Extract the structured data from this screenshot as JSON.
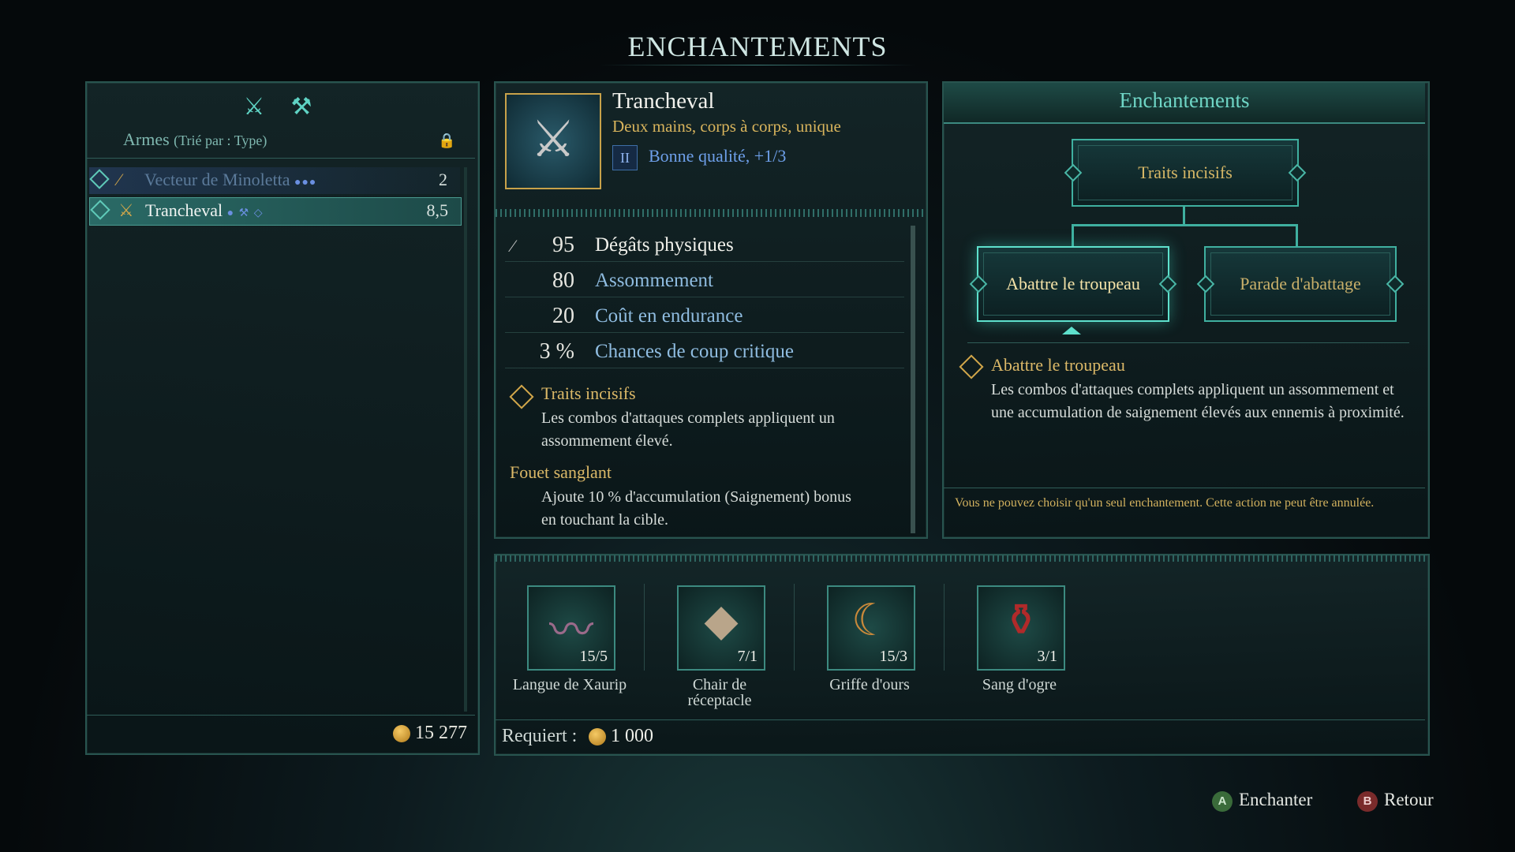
{
  "screen_title": "ENCHANTEMENTS",
  "inventory": {
    "category_label": "Armes",
    "sort_label": "(Trié par : Type)",
    "items": [
      {
        "name": "Vecteur de Minoletta",
        "value": "2",
        "pips": "●●●"
      },
      {
        "name": "Trancheval",
        "value": "8,5",
        "pips": "●"
      }
    ],
    "gold_total": "15 277"
  },
  "item": {
    "name": "Trancheval",
    "subtitle": "Deux mains, corps à corps, unique",
    "quality_tier": "II",
    "quality_text": "Bonne qualité, +1/3",
    "stats": [
      {
        "value": "95",
        "label": "Dégâts physiques"
      },
      {
        "value": "80",
        "label": "Assommement"
      },
      {
        "value": "20",
        "label": "Coût en endurance"
      },
      {
        "value": "3 %",
        "label": "Chances de coup critique"
      }
    ],
    "traits": [
      {
        "name": "Traits incisifs",
        "text_line1": "Les combos d'attaques complets appliquent un",
        "text_line2": "assommement élevé."
      },
      {
        "name": "Fouet sanglant",
        "text_line1": "Ajoute 10 % d'accumulation (Saignement) bonus",
        "text_line2": "en touchant la cible."
      }
    ]
  },
  "enchant_panel": {
    "title": "Enchantements",
    "root": "Traits incisifs",
    "options": [
      "Abattre le troupeau",
      "Parade d'abattage"
    ],
    "selected_name": "Abattre le troupeau",
    "selected_text": "Les combos d'attaques complets appliquent un assommement et une accumulation de saignement élevés aux ennemis à proximité.",
    "warning": "Vous ne pouvez choisir qu'un seul enchantement. Cette action ne peut être annulée."
  },
  "materials": [
    {
      "name": "Langue de Xaurip",
      "count": "15/5",
      "icon": "tongue-icon"
    },
    {
      "name_line1": "Chair de",
      "name_line2": "réceptacle",
      "count": "7/1",
      "icon": "flesh-icon"
    },
    {
      "name": "Griffe d'ours",
      "count": "15/3",
      "icon": "claw-icon"
    },
    {
      "name": "Sang d'ogre",
      "count": "3/1",
      "icon": "potion-icon"
    }
  ],
  "requirement": {
    "label": "Requiert :",
    "value": "1 000"
  },
  "prompts": {
    "a_key": "A",
    "a_label": "Enchanter",
    "b_key": "B",
    "b_label": "Retour"
  },
  "colors": {
    "accent": "#3fb0a0",
    "gold_text": "#dcb968",
    "quality_blue": "#6ea0ea"
  }
}
